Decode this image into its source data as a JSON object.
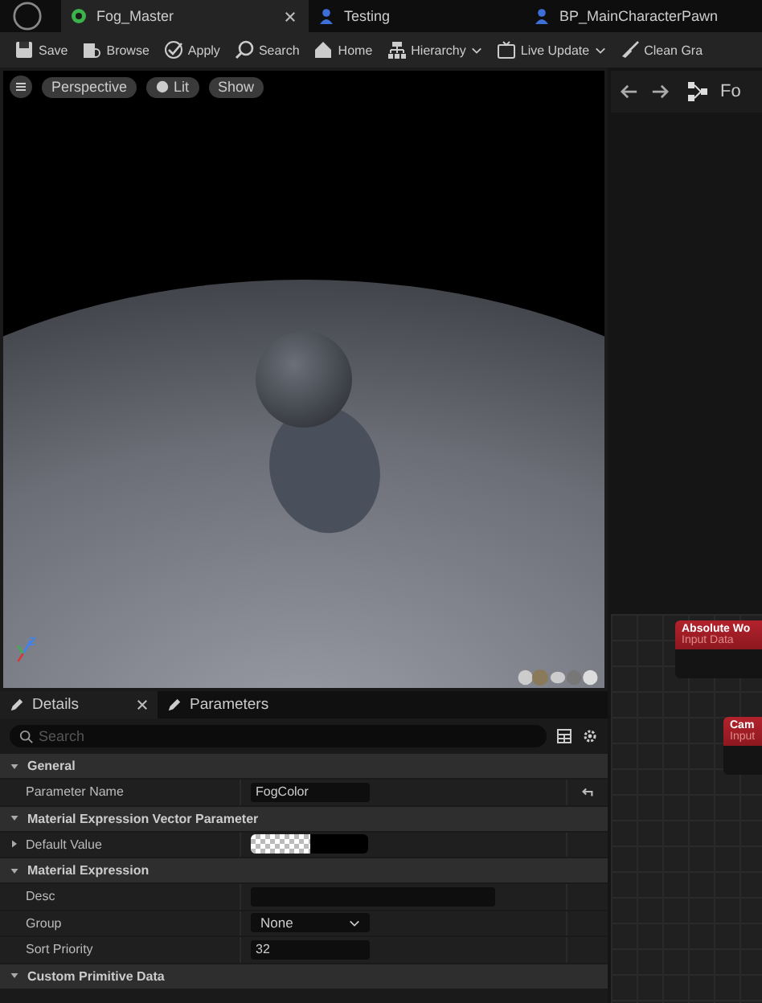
{
  "document_tabs": [
    {
      "label": "Fog_Master",
      "kind": "material",
      "selected": true,
      "closable": true
    },
    {
      "label": "Testing",
      "kind": "blueprint",
      "selected": false,
      "closable": false
    },
    {
      "label": "BP_MainCharacterPawn",
      "kind": "blueprint",
      "selected": false,
      "closable": false
    }
  ],
  "toolbar": [
    {
      "label": "Save",
      "kind": "save",
      "dropdown": false
    },
    {
      "label": "Browse",
      "kind": "browse",
      "dropdown": false
    },
    {
      "label": "Apply",
      "kind": "apply",
      "dropdown": false
    },
    {
      "label": "Search",
      "kind": "search",
      "dropdown": false
    },
    {
      "label": "Home",
      "kind": "home",
      "dropdown": false
    },
    {
      "label": "Hierarchy",
      "kind": "hierarchy",
      "dropdown": true
    },
    {
      "label": "Live Update",
      "kind": "live",
      "dropdown": true
    },
    {
      "label": "Clean Gra",
      "kind": "clean",
      "dropdown": false
    }
  ],
  "viewport": {
    "buttons": [
      {
        "label": "Perspective",
        "kind": "plain"
      },
      {
        "label": "Lit",
        "kind": "lit"
      },
      {
        "label": "Show",
        "kind": "plain"
      }
    ]
  },
  "details": {
    "tabs": [
      {
        "label": "Details",
        "selected": true,
        "closable": true
      },
      {
        "label": "Parameters",
        "selected": false,
        "closable": false
      }
    ],
    "search": {
      "placeholder": "Search"
    },
    "sections": [
      {
        "title": "General",
        "expanded": true,
        "rows": [
          {
            "label": "Parameter Name",
            "kind": "text",
            "value": "FogColor",
            "reset": true
          }
        ]
      },
      {
        "title": "Material Expression Vector Parameter",
        "expanded": true,
        "rows": [
          {
            "label": "Default Value",
            "kind": "color",
            "expandable": true,
            "reset": false
          }
        ]
      },
      {
        "title": "Material Expression",
        "expanded": true,
        "rows": [
          {
            "label": "Desc",
            "kind": "wide",
            "reset": false
          },
          {
            "label": "Group",
            "kind": "dropdown",
            "value": "None",
            "reset": false
          },
          {
            "label": "Sort Priority",
            "kind": "text",
            "value": "32",
            "reset": false
          }
        ]
      },
      {
        "title": "Custom Primitive Data",
        "expanded": true
      }
    ]
  },
  "graph": {
    "breadcrumb": "Fo",
    "nodes": [
      {
        "title": "Absolute Wo",
        "subtitle": "Input Data",
        "kind": "upper"
      },
      {
        "title": "Cam",
        "subtitle": "Input",
        "kind": "lower"
      }
    ]
  }
}
